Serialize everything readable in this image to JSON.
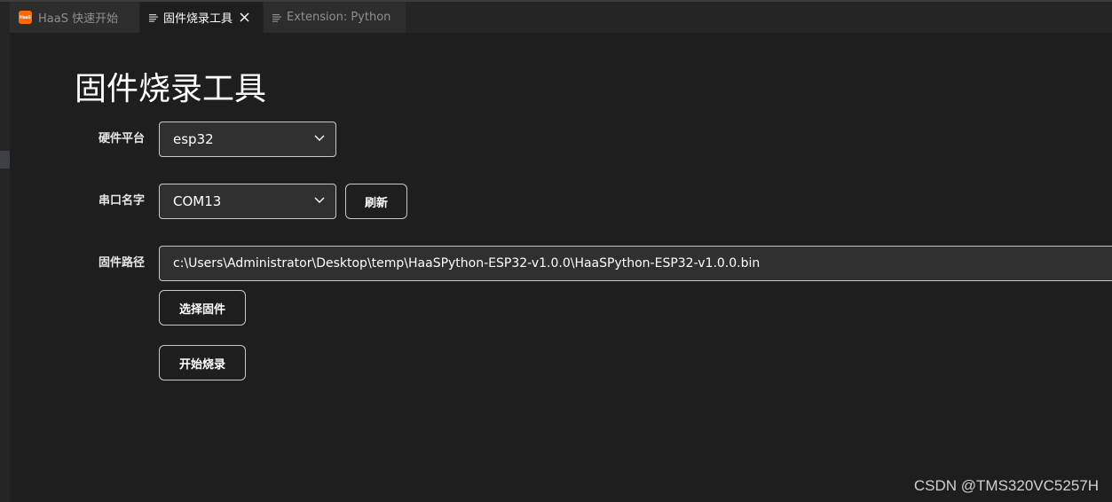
{
  "tabs": [
    {
      "label": "HaaS 快速开始",
      "logo_text": "HaaS",
      "icon": "haas-logo-icon"
    },
    {
      "label": "固件烧录工具",
      "icon": "document-icon",
      "active": true
    },
    {
      "label": "Extension: Python",
      "icon": "document-icon"
    }
  ],
  "page": {
    "title": "固件烧录工具"
  },
  "form": {
    "platform_label": "硬件平台",
    "platform_value": "esp32",
    "port_label": "串口名字",
    "port_value": "COM13",
    "refresh_label": "刷新",
    "firmware_label": "固件路径",
    "firmware_path": "c:\\Users\\Administrator\\Desktop\\temp\\HaaSPython-ESP32-v1.0.0\\HaaSPython-ESP32-v1.0.0.bin",
    "choose_label": "选择固件",
    "start_label": "开始烧录"
  },
  "watermark": "CSDN @TMS320VC5257H",
  "colors": {
    "background": "#1e1e1e",
    "tab_inactive": "#2d2d2d",
    "haas_brand": "#ff6a00",
    "input_bg": "#303030",
    "border": "#c8c8c8"
  }
}
